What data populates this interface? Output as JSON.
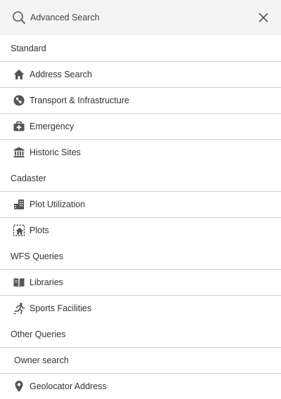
{
  "header": {
    "title": "Advanced Search",
    "icon": "search-icon",
    "close_icon": "close-icon"
  },
  "groups": [
    {
      "label": "Standard",
      "items": [
        {
          "label": "Address Search",
          "icon": "home-icon"
        },
        {
          "label": "Transport & Infrastructure",
          "icon": "transport-icon"
        },
        {
          "label": "Emergency",
          "icon": "first-aid-kit-icon"
        },
        {
          "label": "Historic Sites",
          "icon": "museum-icon"
        }
      ]
    },
    {
      "label": "Cadaster",
      "items": [
        {
          "label": "Plot Utilization",
          "icon": "buildings-icon"
        },
        {
          "label": "Plots",
          "icon": "plot-house-icon"
        }
      ]
    },
    {
      "label": "WFS Queries",
      "items": [
        {
          "label": "Libraries",
          "icon": "book-icon"
        },
        {
          "label": "Sports Facilities",
          "icon": "runner-icon"
        }
      ]
    },
    {
      "label": "Other Queries",
      "items": [
        {
          "label": "Owner search",
          "icon": ""
        },
        {
          "label": "Geolocator Address",
          "icon": "map-pin-icon"
        }
      ]
    }
  ],
  "colors": {
    "header_bg": "#f4f4f4",
    "icon": "#555555",
    "divider": "#cfcfcf",
    "text": "#333333"
  }
}
